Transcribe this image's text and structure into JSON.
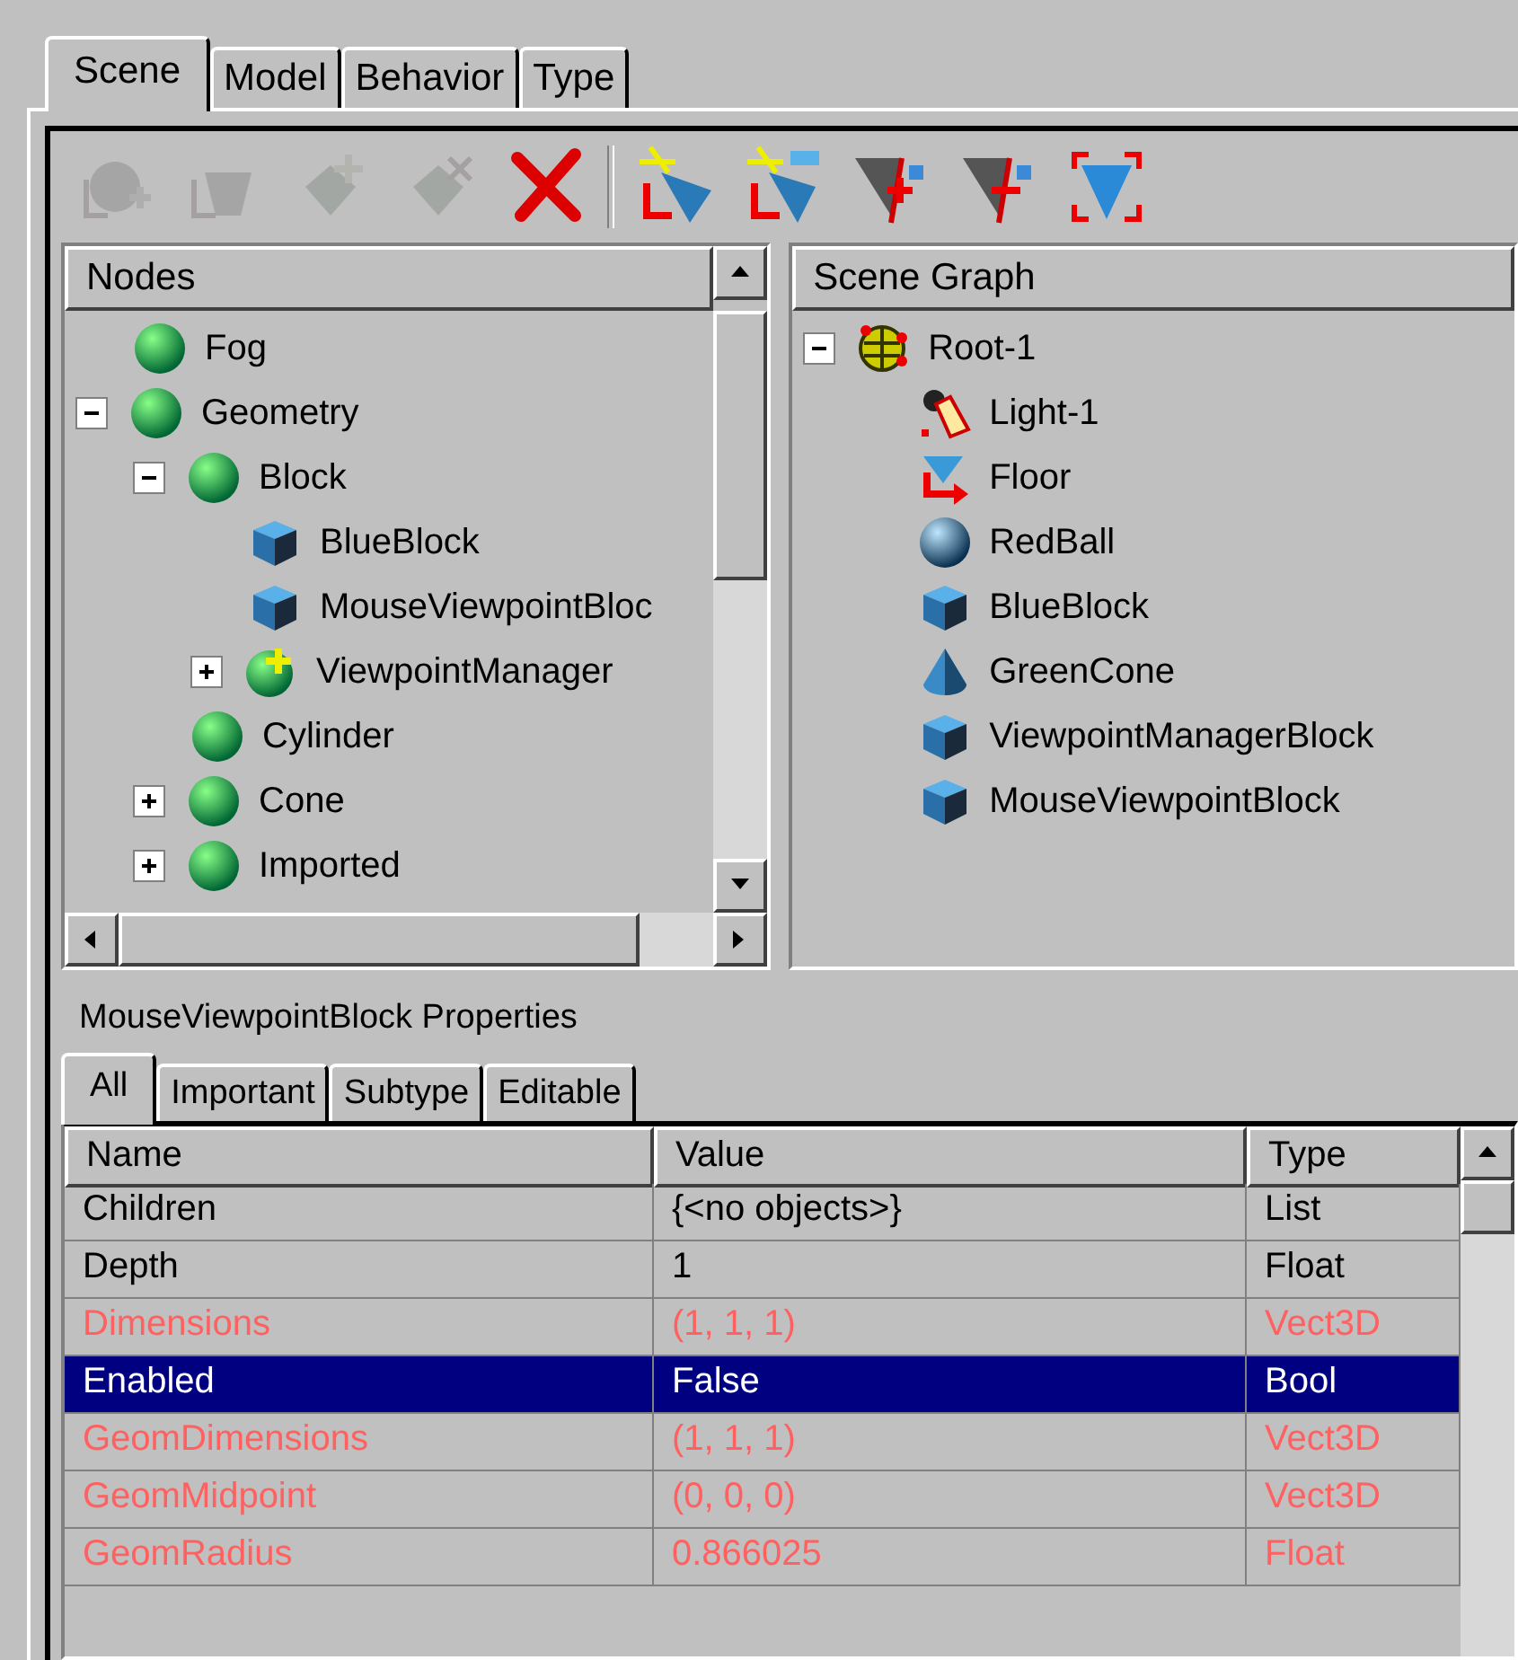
{
  "tabs": [
    {
      "label": "Scene",
      "selected": true
    },
    {
      "label": "Model",
      "selected": false
    },
    {
      "label": "Behavior",
      "selected": false
    },
    {
      "label": "Type",
      "selected": false
    }
  ],
  "toolbar": [
    {
      "kind": "add-sphere",
      "disabled": true
    },
    {
      "kind": "add-block",
      "disabled": true
    },
    {
      "kind": "add-part",
      "disabled": true
    },
    {
      "kind": "remove-part",
      "disabled": true
    },
    {
      "kind": "delete",
      "disabled": false
    },
    {
      "kind": "sep"
    },
    {
      "kind": "insert-shape",
      "disabled": false
    },
    {
      "kind": "insert-grid",
      "disabled": false
    },
    {
      "kind": "split-add",
      "disabled": false
    },
    {
      "kind": "split-remove",
      "disabled": false
    },
    {
      "kind": "frame",
      "disabled": false
    }
  ],
  "nodes": {
    "header": "Nodes",
    "items": [
      {
        "label": "Fog",
        "kind": "sphere"
      },
      {
        "label": "Geometry",
        "kind": "sphere",
        "expanded": true,
        "children": [
          {
            "label": "Block",
            "kind": "sphere",
            "expanded": true,
            "children": [
              {
                "label": "BlueBlock",
                "kind": "cube"
              },
              {
                "label": "MouseViewpointBloc",
                "kind": "cube"
              },
              {
                "label": "ViewpointManager",
                "kind": "sphere-plus",
                "expanded": false
              }
            ]
          },
          {
            "label": "Cylinder",
            "kind": "sphere"
          },
          {
            "label": "Cone",
            "kind": "sphere",
            "expanded": false
          },
          {
            "label": "Imported",
            "kind": "sphere",
            "expanded": false
          }
        ]
      }
    ]
  },
  "scene_graph": {
    "header": "Scene Graph",
    "items": [
      {
        "label": "Root-1",
        "kind": "root",
        "expanded": true,
        "children": [
          {
            "label": "Light-1",
            "kind": "light"
          },
          {
            "label": "Floor",
            "kind": "floor"
          },
          {
            "label": "RedBall",
            "kind": "ball"
          },
          {
            "label": "BlueBlock",
            "kind": "cube"
          },
          {
            "label": "GreenCone",
            "kind": "cone"
          },
          {
            "label": "ViewpointManagerBlock",
            "kind": "cube"
          },
          {
            "label": "MouseViewpointBlock",
            "kind": "cube"
          }
        ]
      }
    ]
  },
  "properties": {
    "title": "MouseViewpointBlock Properties",
    "tabs": [
      {
        "label": "All",
        "selected": true
      },
      {
        "label": "Important",
        "selected": false
      },
      {
        "label": "Subtype",
        "selected": false
      },
      {
        "label": "Editable",
        "selected": false
      }
    ],
    "columns": [
      "Name",
      "Value",
      "Type"
    ],
    "rows": [
      {
        "cells": [
          "Children",
          "{<no objects>}",
          "List"
        ],
        "readonly": false,
        "selected": false
      },
      {
        "cells": [
          "Depth",
          "1",
          "Float"
        ],
        "readonly": false,
        "selected": false
      },
      {
        "cells": [
          "Dimensions",
          "(1, 1, 1)",
          "Vect3D"
        ],
        "readonly": true,
        "selected": false
      },
      {
        "cells": [
          "Enabled",
          "False",
          "Bool"
        ],
        "readonly": false,
        "selected": true
      },
      {
        "cells": [
          "GeomDimensions",
          "(1, 1, 1)",
          "Vect3D"
        ],
        "readonly": true,
        "selected": false
      },
      {
        "cells": [
          "GeomMidpoint",
          "(0, 0, 0)",
          "Vect3D"
        ],
        "readonly": true,
        "selected": false
      },
      {
        "cells": [
          "GeomRadius",
          "0.866025",
          "Float"
        ],
        "readonly": true,
        "selected": false
      }
    ]
  }
}
